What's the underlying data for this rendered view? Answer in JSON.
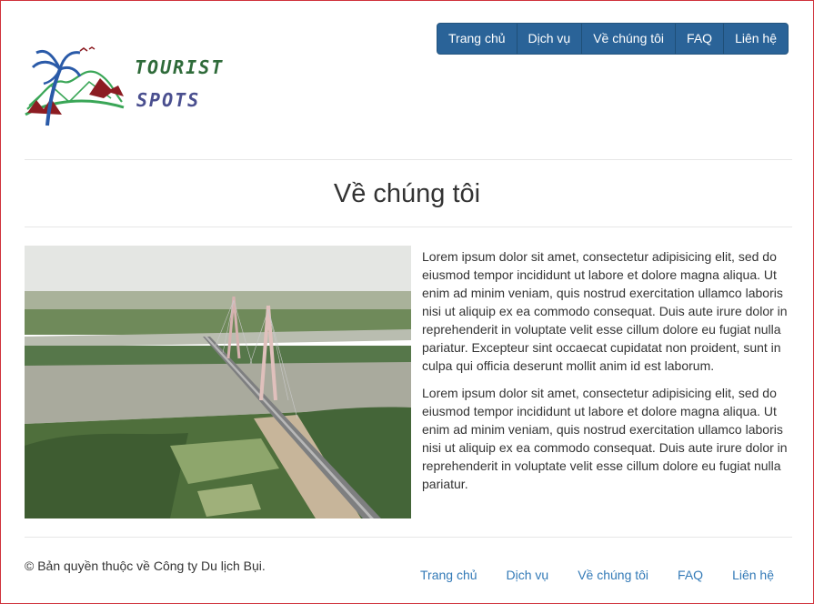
{
  "logo": {
    "line1": "TOURIST",
    "line2": "SPOTS",
    "colors": {
      "green": "#2f6b3a",
      "blue": "#2a5aa8",
      "red": "#8c1c22"
    }
  },
  "nav": {
    "items": [
      "Trang chủ",
      "Dịch vụ",
      "Về chúng tôi",
      "FAQ",
      "Liên hệ"
    ],
    "bg_color": "#2a6398"
  },
  "main": {
    "title": "Về chúng tôi",
    "paragraphs": [
      "Lorem ipsum dolor sit amet, consectetur adipisicing elit, sed do eiusmod tempor incididunt ut labore et dolore magna aliqua. Ut enim ad minim veniam, quis nostrud exercitation ullamco laboris nisi ut aliquip ex ea commodo consequat. Duis aute irure dolor in reprehenderit in voluptate velit esse cillum dolore eu fugiat nulla pariatur. Excepteur sint occaecat cupidatat non proident, sunt in culpa qui officia deserunt mollit anim id est laborum.",
      "Lorem ipsum dolor sit amet, consectetur adipisicing elit, sed do eiusmod tempor incididunt ut labore et dolore magna aliqua. Ut enim ad minim veniam, quis nostrud exercitation ullamco laboris nisi ut aliquip ex ea commodo consequat. Duis aute irure dolor in reprehenderit in voluptate velit esse cillum dolore eu fugiat nulla pariatur."
    ]
  },
  "footer": {
    "copyright": "© Bản quyền thuộc về Công ty Du lịch Bụi.",
    "links": [
      "Trang chủ",
      "Dịch vụ",
      "Về chúng tôi",
      "FAQ",
      "Liên hệ"
    ],
    "link_color": "#337ab7"
  }
}
